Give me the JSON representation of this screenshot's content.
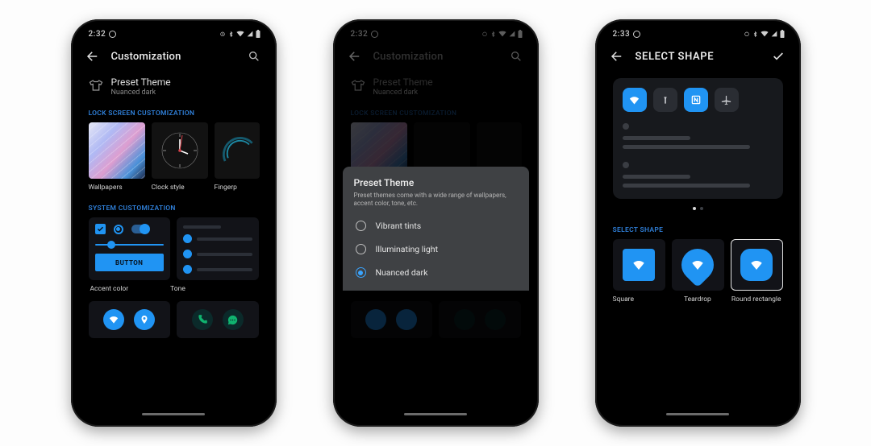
{
  "status": {
    "time1": "2:32",
    "time3": "2:33"
  },
  "screen1": {
    "title": "Customization",
    "preset_label": "Preset Theme",
    "preset_sub": "Nuanced dark",
    "sec_lock": "LOCK SCREEN CUSTOMIZATION",
    "tile1": "Wallpapers",
    "tile2": "Clock style",
    "tile3": "Fingerp",
    "sec_sys": "SYSTEM CUSTOMIZATION",
    "button_label": "BUTTON",
    "cap1": "Accent color",
    "cap2": "Tone"
  },
  "sheet": {
    "title": "Preset Theme",
    "desc": "Preset themes come with a wide range of wallpapers, accent color, tone, etc.",
    "opt1": "Vibrant tints",
    "opt2": "Illuminating light",
    "opt3": "Nuanced dark"
  },
  "screen3": {
    "title": "SELECT SHAPE",
    "sec_label": "SELECT SHAPE",
    "s1": "Square",
    "s2": "Teardrop",
    "s3": "Round rectangle"
  }
}
